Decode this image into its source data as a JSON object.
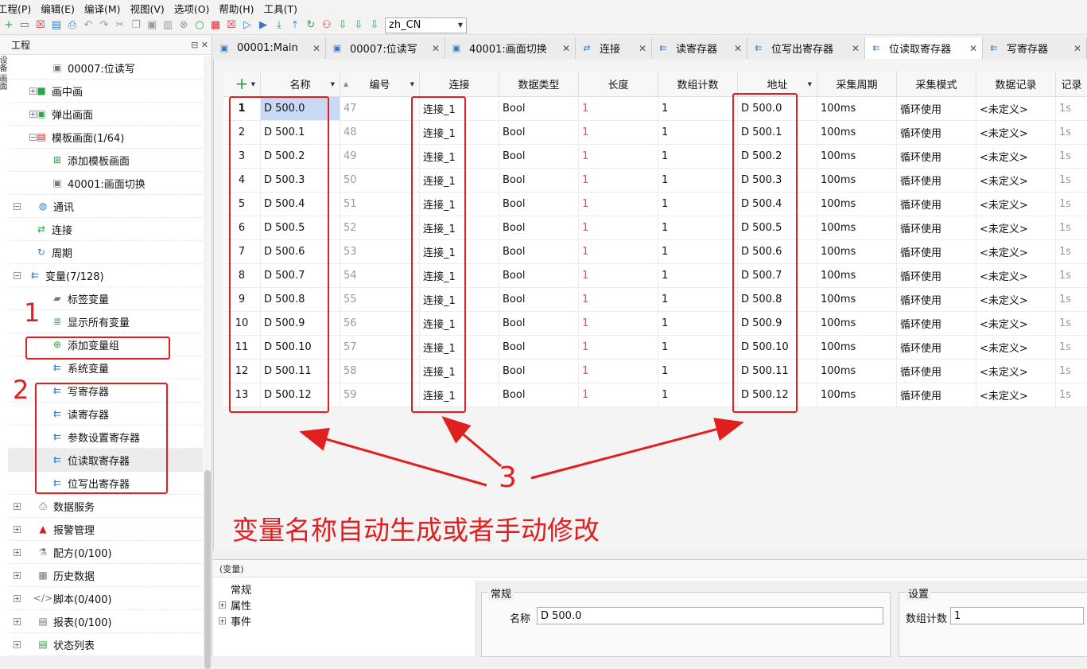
{
  "menu": [
    "工程(P)",
    "编辑(E)",
    "编译(M)",
    "视图(V)",
    "选项(O)",
    "帮助(H)",
    "工具(T)"
  ],
  "toolbar": {
    "language": "zh_CN"
  },
  "left_panel": {
    "title": "工程",
    "side_strip": "设备 画面",
    "tree": [
      {
        "label": "00007:位读写",
        "indent": 2,
        "icon": "screen-icon",
        "glyph": "▣",
        "cls": "i-gray",
        "exp": "",
        "sel": false
      },
      {
        "label": "画中画",
        "indent": 1,
        "icon": "picture-in-picture-icon",
        "glyph": "■",
        "cls": "i-green",
        "exp": "+",
        "sel": false
      },
      {
        "label": "弹出画面",
        "indent": 1,
        "icon": "popup-screen-icon",
        "glyph": "▣",
        "cls": "i-green",
        "exp": "+",
        "sel": false
      },
      {
        "label": "模板画面(1/64)",
        "indent": 1,
        "icon": "template-screen-icon",
        "glyph": "▤",
        "cls": "i-red",
        "exp": "−",
        "sel": false
      },
      {
        "label": "添加模板画面",
        "indent": 2,
        "icon": "add-template-icon",
        "glyph": "⊞",
        "cls": "i-green",
        "exp": "",
        "sel": false
      },
      {
        "label": "40001:画面切换",
        "indent": 2,
        "icon": "screen-icon",
        "glyph": "▣",
        "cls": "i-gray",
        "exp": "",
        "sel": false
      },
      {
        "label": "通讯",
        "indent": 0,
        "icon": "globe-icon",
        "glyph": "◍",
        "cls": "i-blue",
        "exp": "−",
        "sel": false
      },
      {
        "label": "连接",
        "indent": 1,
        "icon": "connection-icon",
        "glyph": "⇄",
        "cls": "i-green",
        "exp": "",
        "sel": false
      },
      {
        "label": "周期",
        "indent": 1,
        "icon": "cycle-icon",
        "glyph": "↻",
        "cls": "i-blue",
        "exp": "",
        "sel": false
      },
      {
        "label": "变量(7/128)",
        "indent": 0,
        "icon": "variable-icon",
        "glyph": "⇇",
        "cls": "i-blue",
        "exp": "−",
        "sel": false,
        "shift": true
      },
      {
        "label": "标签变量",
        "indent": 2,
        "icon": "tag-folder-icon",
        "glyph": "▰",
        "cls": "i-gray",
        "exp": "",
        "sel": false
      },
      {
        "label": "显示所有变量",
        "indent": 2,
        "icon": "show-all-variables-icon",
        "glyph": "≣",
        "cls": "i-green",
        "exp": "",
        "sel": false
      },
      {
        "label": "添加变量组",
        "indent": 2,
        "icon": "add-variable-group-icon",
        "glyph": "⊕",
        "cls": "i-green",
        "exp": "",
        "sel": false
      },
      {
        "label": "系统变量",
        "indent": 2,
        "icon": "variable-icon",
        "glyph": "⇇",
        "cls": "i-blue",
        "exp": "",
        "sel": false
      },
      {
        "label": "写寄存器",
        "indent": 2,
        "icon": "variable-icon",
        "glyph": "⇇",
        "cls": "i-blue",
        "exp": "",
        "sel": false
      },
      {
        "label": "读寄存器",
        "indent": 2,
        "icon": "variable-icon",
        "glyph": "⇇",
        "cls": "i-blue",
        "exp": "",
        "sel": false
      },
      {
        "label": "参数设置寄存器",
        "indent": 2,
        "icon": "variable-icon",
        "glyph": "⇇",
        "cls": "i-blue",
        "exp": "",
        "sel": false
      },
      {
        "label": "位读取寄存器",
        "indent": 2,
        "icon": "variable-icon",
        "glyph": "⇇",
        "cls": "i-blue",
        "exp": "",
        "sel": true
      },
      {
        "label": "位写出寄存器",
        "indent": 2,
        "icon": "variable-icon",
        "glyph": "⇇",
        "cls": "i-blue",
        "exp": "",
        "sel": false
      },
      {
        "label": "数据服务",
        "indent": 0,
        "icon": "data-service-icon",
        "glyph": "⎙",
        "cls": "i-gray",
        "exp": "+",
        "sel": false
      },
      {
        "label": "报警管理",
        "indent": 0,
        "icon": "alarm-icon",
        "glyph": "▲",
        "cls": "i-red",
        "exp": "+",
        "sel": false
      },
      {
        "label": "配方(0/100)",
        "indent": 0,
        "icon": "recipe-flask-icon",
        "glyph": "⚗",
        "cls": "i-gray",
        "exp": "+",
        "sel": false
      },
      {
        "label": "历史数据",
        "indent": 0,
        "icon": "history-data-icon",
        "glyph": "▦",
        "cls": "i-gray",
        "exp": "+",
        "sel": false
      },
      {
        "label": "脚本(0/400)",
        "indent": 0,
        "icon": "script-icon",
        "glyph": "</>",
        "cls": "i-gray",
        "exp": "+",
        "sel": false
      },
      {
        "label": "报表(0/100)",
        "indent": 0,
        "icon": "report-icon",
        "glyph": "▤",
        "cls": "i-gray",
        "exp": "+",
        "sel": false
      },
      {
        "label": "状态列表",
        "indent": 0,
        "icon": "status-list-icon",
        "glyph": "▤",
        "cls": "i-green",
        "exp": "+",
        "sel": false
      }
    ]
  },
  "tabs": [
    {
      "label": "00001:Main",
      "icon": "screen-icon",
      "glyph": "▣",
      "width": 142,
      "active": false
    },
    {
      "label": "00007:位读写",
      "icon": "screen-icon",
      "glyph": "▣",
      "width": 150,
      "active": false
    },
    {
      "label": "40001:画面切换",
      "icon": "screen-icon",
      "glyph": "▣",
      "width": 164,
      "active": false
    },
    {
      "label": "连接",
      "icon": "connection-icon",
      "glyph": "⇄",
      "width": 96,
      "active": false
    },
    {
      "label": "读寄存器",
      "icon": "variable-icon",
      "glyph": "⇇",
      "width": 120,
      "active": false
    },
    {
      "label": "位写出寄存器",
      "icon": "variable-icon",
      "glyph": "⇇",
      "width": 148,
      "active": false
    },
    {
      "label": "位读取寄存器",
      "icon": "variable-icon",
      "glyph": "⇇",
      "width": 148,
      "active": true
    },
    {
      "label": "写寄存器",
      "icon": "variable-icon",
      "glyph": "⇇",
      "width": 131,
      "active": false
    }
  ],
  "grid": {
    "columns": [
      "",
      "名称",
      "编号",
      "连接",
      "数据类型",
      "长度",
      "数组计数",
      "地址",
      "采集周期",
      "采集模式",
      "数据记录",
      "记录"
    ],
    "rows": [
      [
        "1",
        "D 500.0",
        "47",
        "连接_1",
        "Bool",
        "1",
        "1",
        "D 500.0",
        "100ms",
        "循环使用",
        "<未定义>",
        "1s"
      ],
      [
        "2",
        "D 500.1",
        "48",
        "连接_1",
        "Bool",
        "1",
        "1",
        "D 500.1",
        "100ms",
        "循环使用",
        "<未定义>",
        "1s"
      ],
      [
        "3",
        "D 500.2",
        "49",
        "连接_1",
        "Bool",
        "1",
        "1",
        "D 500.2",
        "100ms",
        "循环使用",
        "<未定义>",
        "1s"
      ],
      [
        "4",
        "D 500.3",
        "50",
        "连接_1",
        "Bool",
        "1",
        "1",
        "D 500.3",
        "100ms",
        "循环使用",
        "<未定义>",
        "1s"
      ],
      [
        "5",
        "D 500.4",
        "51",
        "连接_1",
        "Bool",
        "1",
        "1",
        "D 500.4",
        "100ms",
        "循环使用",
        "<未定义>",
        "1s"
      ],
      [
        "6",
        "D 500.5",
        "52",
        "连接_1",
        "Bool",
        "1",
        "1",
        "D 500.5",
        "100ms",
        "循环使用",
        "<未定义>",
        "1s"
      ],
      [
        "7",
        "D 500.6",
        "53",
        "连接_1",
        "Bool",
        "1",
        "1",
        "D 500.6",
        "100ms",
        "循环使用",
        "<未定义>",
        "1s"
      ],
      [
        "8",
        "D 500.7",
        "54",
        "连接_1",
        "Bool",
        "1",
        "1",
        "D 500.7",
        "100ms",
        "循环使用",
        "<未定义>",
        "1s"
      ],
      [
        "9",
        "D 500.8",
        "55",
        "连接_1",
        "Bool",
        "1",
        "1",
        "D 500.8",
        "100ms",
        "循环使用",
        "<未定义>",
        "1s"
      ],
      [
        "10",
        "D 500.9",
        "56",
        "连接_1",
        "Bool",
        "1",
        "1",
        "D 500.9",
        "100ms",
        "循环使用",
        "<未定义>",
        "1s"
      ],
      [
        "11",
        "D 500.10",
        "57",
        "连接_1",
        "Bool",
        "1",
        "1",
        "D 500.10",
        "100ms",
        "循环使用",
        "<未定义>",
        "1s"
      ],
      [
        "12",
        "D 500.11",
        "58",
        "连接_1",
        "Bool",
        "1",
        "1",
        "D 500.11",
        "100ms",
        "循环使用",
        "<未定义>",
        "1s"
      ],
      [
        "13",
        "D 500.12",
        "59",
        "连接_1",
        "Bool",
        "1",
        "1",
        "D 500.12",
        "100ms",
        "循环使用",
        "<未定义>",
        "1s"
      ]
    ]
  },
  "annotations": {
    "label1": "1",
    "label2": "2",
    "label3": "3",
    "caption": "变量名称自动生成或者手动修改",
    "color": "#e02020"
  },
  "bottom_panel": {
    "title": "(变量)",
    "tree": [
      "常规",
      "属性",
      "事件"
    ],
    "general": {
      "legend": "常规",
      "name_label": "名称",
      "name_value": "D 500.0"
    },
    "settings": {
      "legend": "设置",
      "array_count_label": "数组计数",
      "array_count_value": "1"
    }
  }
}
